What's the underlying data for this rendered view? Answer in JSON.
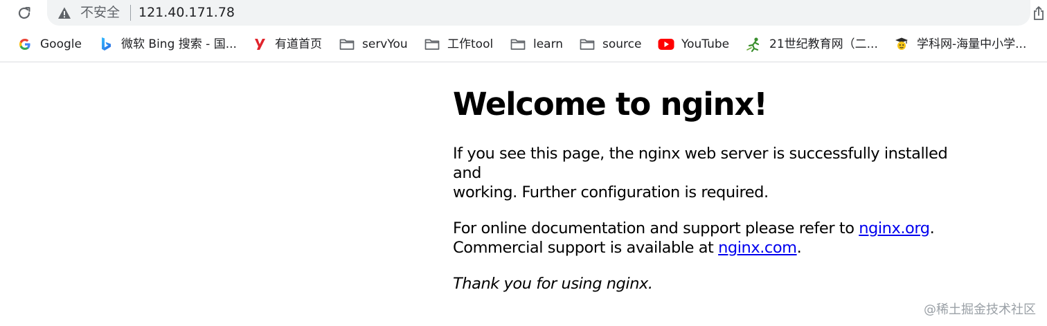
{
  "browser": {
    "security_label": "不安全",
    "url": "121.40.171.78"
  },
  "bookmarks": [
    {
      "label": "Google",
      "icon": "google-icon"
    },
    {
      "label": "微软 Bing 搜索 - 国...",
      "icon": "bing-icon"
    },
    {
      "label": "有道首页",
      "icon": "youdao-icon"
    },
    {
      "label": "servYou",
      "icon": "folder-icon"
    },
    {
      "label": "工作tool",
      "icon": "folder-icon"
    },
    {
      "label": "learn",
      "icon": "folder-icon"
    },
    {
      "label": "source",
      "icon": "folder-icon"
    },
    {
      "label": "YouTube",
      "icon": "youtube-icon"
    },
    {
      "label": "21世纪教育网（二...",
      "icon": "21cnjy-icon"
    },
    {
      "label": "学科网-海量中小学...",
      "icon": "zxxk-icon"
    }
  ],
  "page": {
    "heading": "Welcome to nginx!",
    "intro_line1": "If you see this page, the nginx web server is successfully installed and",
    "intro_line2": "working. Further configuration is required.",
    "doc_text": "For online documentation and support please refer to ",
    "doc_link": "nginx.org",
    "doc_end": ".",
    "commercial_text": "Commercial support is available at ",
    "commercial_link": "nginx.com",
    "commercial_end": ".",
    "thanks": "Thank you for using nginx."
  },
  "watermark": "@稀土掘金技术社区",
  "colors": {
    "link": "#0000ee",
    "omnibox_bg": "#f1f3f4",
    "youtube_red": "#ff0000",
    "youdao_red": "#e0242c"
  }
}
